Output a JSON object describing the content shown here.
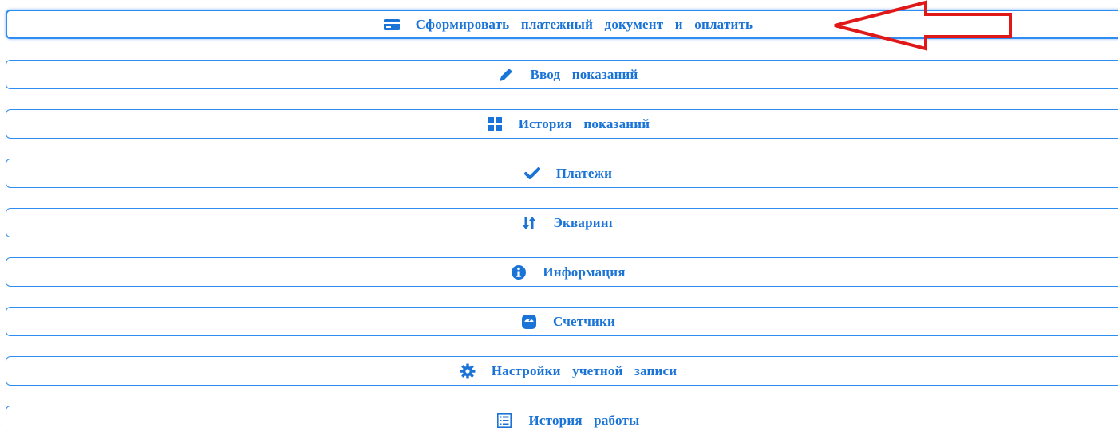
{
  "menu": {
    "items": [
      {
        "label": "Сформировать платежный документ и оплатить",
        "icon": "credit-card-icon"
      },
      {
        "label": "Ввод показаний",
        "icon": "pencil-icon"
      },
      {
        "label": "История показаний",
        "icon": "grid-icon"
      },
      {
        "label": "Платежи",
        "icon": "checkmark-icon"
      },
      {
        "label": "Экваринг",
        "icon": "sort-arrows-icon"
      },
      {
        "label": "Информация",
        "icon": "info-icon"
      },
      {
        "label": "Счетчики",
        "icon": "meter-icon"
      },
      {
        "label": "Настройки учетной записи",
        "icon": "gear-icon"
      },
      {
        "label": "История работы",
        "icon": "list-icon"
      }
    ]
  },
  "colors": {
    "accent": "#1a73d6",
    "border": "#2f8cf0",
    "annotation_arrow": "#e01818"
  }
}
